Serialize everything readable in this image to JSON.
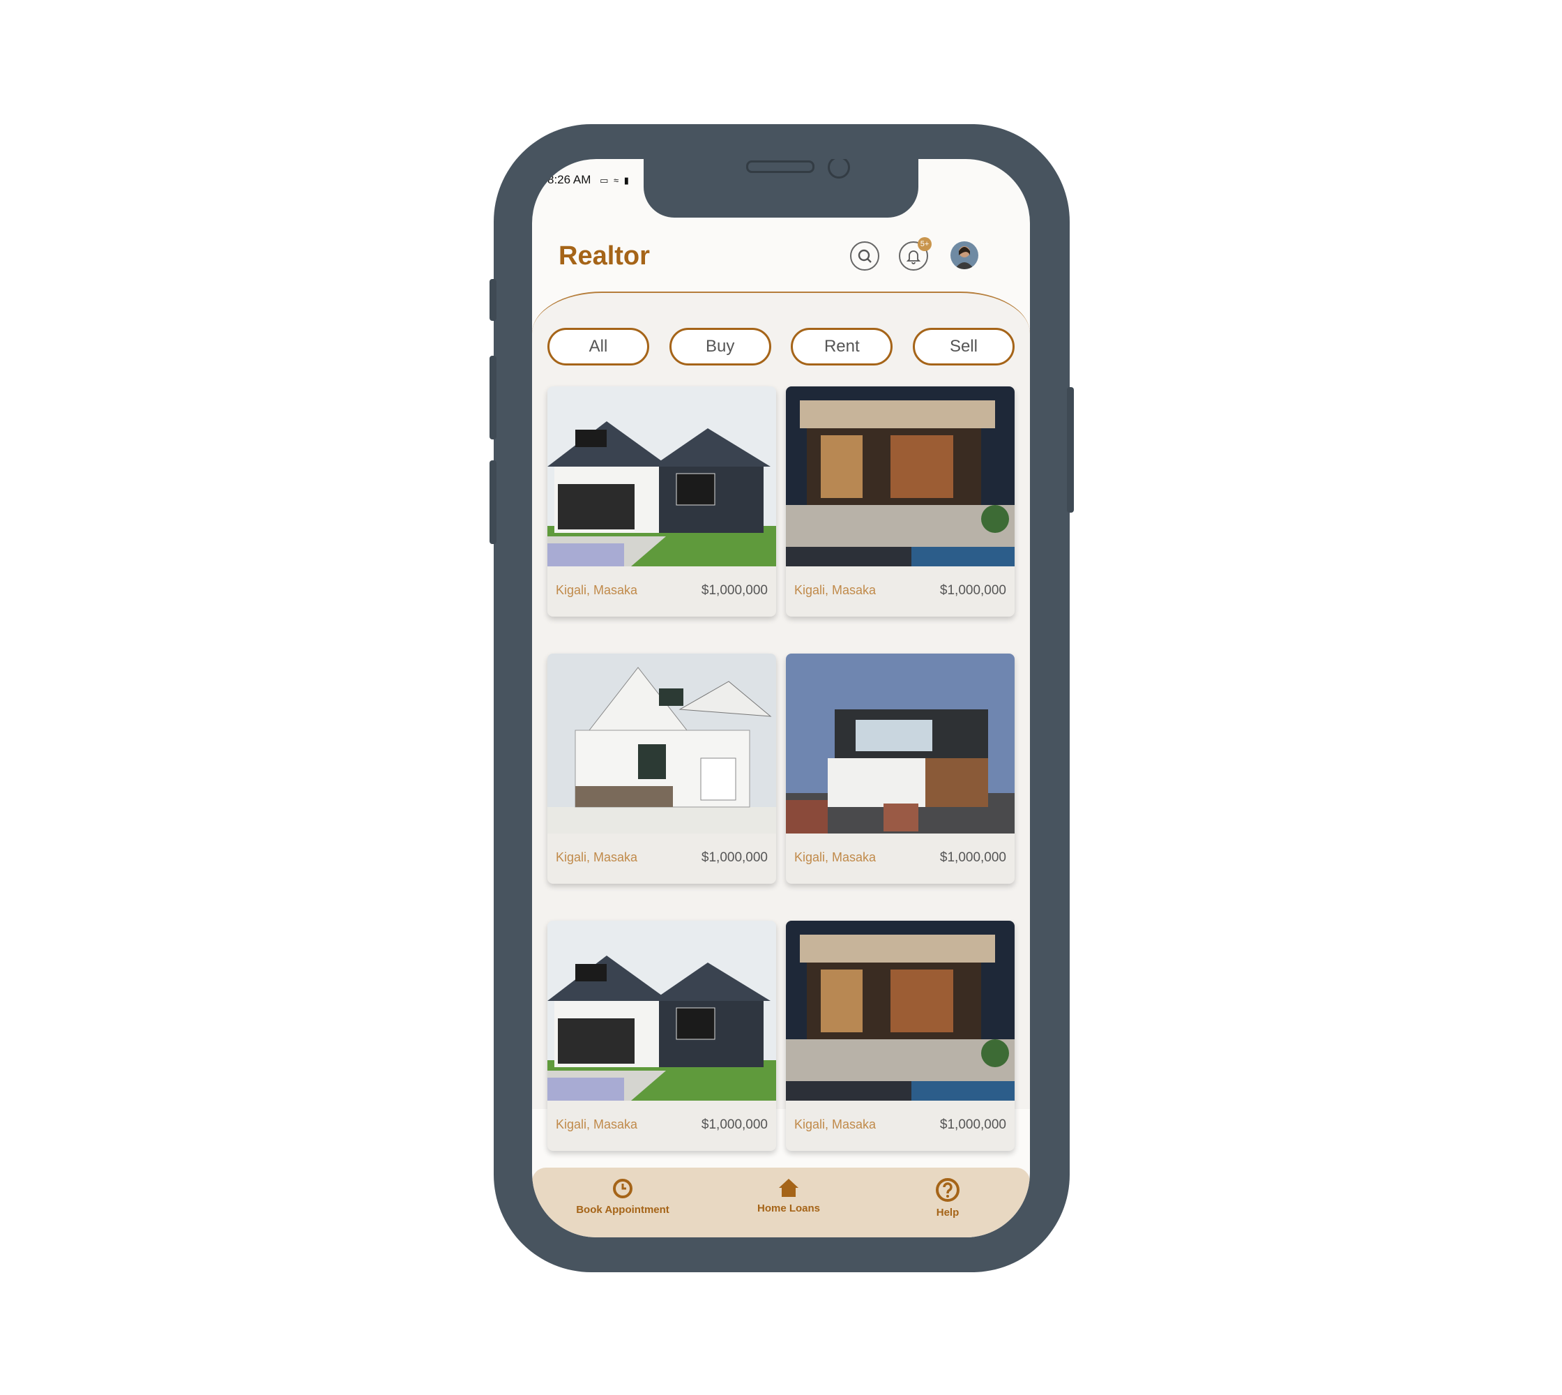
{
  "status_bar": {
    "time": "8:26 AM"
  },
  "header": {
    "title": "Realtor",
    "notification_badge": "5+"
  },
  "filters": [
    "All",
    "Buy",
    "Rent",
    "Sell"
  ],
  "listings": [
    {
      "location": "Kigali, Masaka",
      "price": "$1,000,000",
      "photo": "farmhouse-dark-gable"
    },
    {
      "location": "Kigali, Masaka",
      "price": "$1,000,000",
      "photo": "modern-night-patio"
    },
    {
      "location": "Kigali, Masaka",
      "price": "$1,000,000",
      "photo": "white-farmhouse"
    },
    {
      "location": "Kigali, Masaka",
      "price": "$1,000,000",
      "photo": "modern-dusk-garage"
    },
    {
      "location": "Kigali, Masaka",
      "price": "$1,000,000",
      "photo": "farmhouse-dark-gable"
    },
    {
      "location": "Kigali, Masaka",
      "price": "$1,000,000",
      "photo": "modern-night-patio"
    }
  ],
  "tabbar": [
    {
      "label": "Book Appointment",
      "icon": "clock-icon"
    },
    {
      "label": "Home Loans",
      "icon": "home-icon"
    },
    {
      "label": "Help",
      "icon": "help-icon"
    }
  ],
  "colors": {
    "accent": "#a56418",
    "tabbar_bg": "#e8d8c2",
    "frame": "#48545f"
  }
}
